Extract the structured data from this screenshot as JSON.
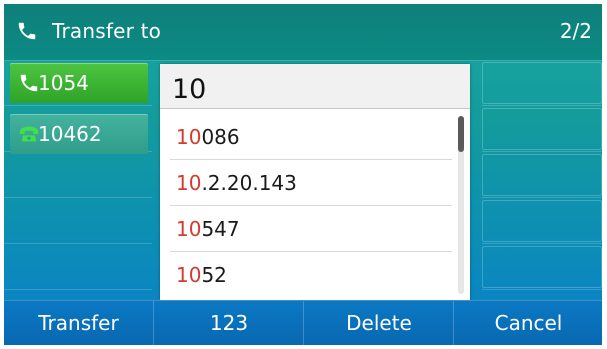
{
  "header": {
    "title": "Transfer to",
    "page_indicator": "2/2",
    "icon": "handset-icon"
  },
  "lines": [
    {
      "label": "1054",
      "state": "active",
      "icon": "handset-icon",
      "color": "#3db535"
    },
    {
      "label": "10462",
      "state": "held",
      "icon": "hold-phone-icon",
      "color": "#35a68f"
    }
  ],
  "search": {
    "value": "10"
  },
  "results": [
    {
      "match": "10",
      "rest": "086"
    },
    {
      "match": "10",
      "rest": ".2.20.143"
    },
    {
      "match": "10",
      "rest": "547"
    },
    {
      "match": "10",
      "rest": "52"
    }
  ],
  "softkeys": [
    {
      "label": "Transfer"
    },
    {
      "label": "123"
    },
    {
      "label": "Delete"
    },
    {
      "label": "Cancel"
    }
  ],
  "colors": {
    "accent": "#0c8a84",
    "match_highlight": "#d43a2f",
    "softkey_bar": "#0868b0"
  }
}
